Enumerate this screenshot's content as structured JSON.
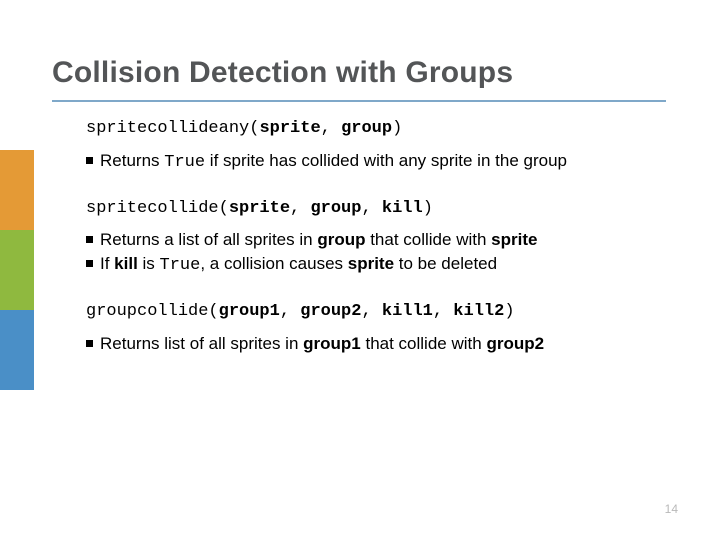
{
  "title": "Collision Detection with Groups",
  "page_number": "14",
  "sections": [
    {
      "code_html": "spritecollideany(<b>sprite</b>, <b>group</b>)",
      "bullets_html": [
        "Returns <span class=\"mono\">True</span> if sprite has collided with any sprite in the group"
      ]
    },
    {
      "code_html": "spritecollide(<b>sprite</b>, <b>group</b>, <b>kill</b>)",
      "bullets_html": [
        "Returns a list of all sprites in <b>group</b> that collide with <b>sprite</b>",
        "If <b>kill</b> is <span class=\"mono\">True</span>, a collision causes <b>sprite</b> to be deleted"
      ]
    },
    {
      "code_html": "groupcollide(<b>group1</b>, <b>group2</b>, <b>kill1</b>, <b>kill2</b>)",
      "bullets_html": [
        "Returns list of all sprites in <b>group1</b> that collide with <b>group2</b>"
      ]
    }
  ]
}
